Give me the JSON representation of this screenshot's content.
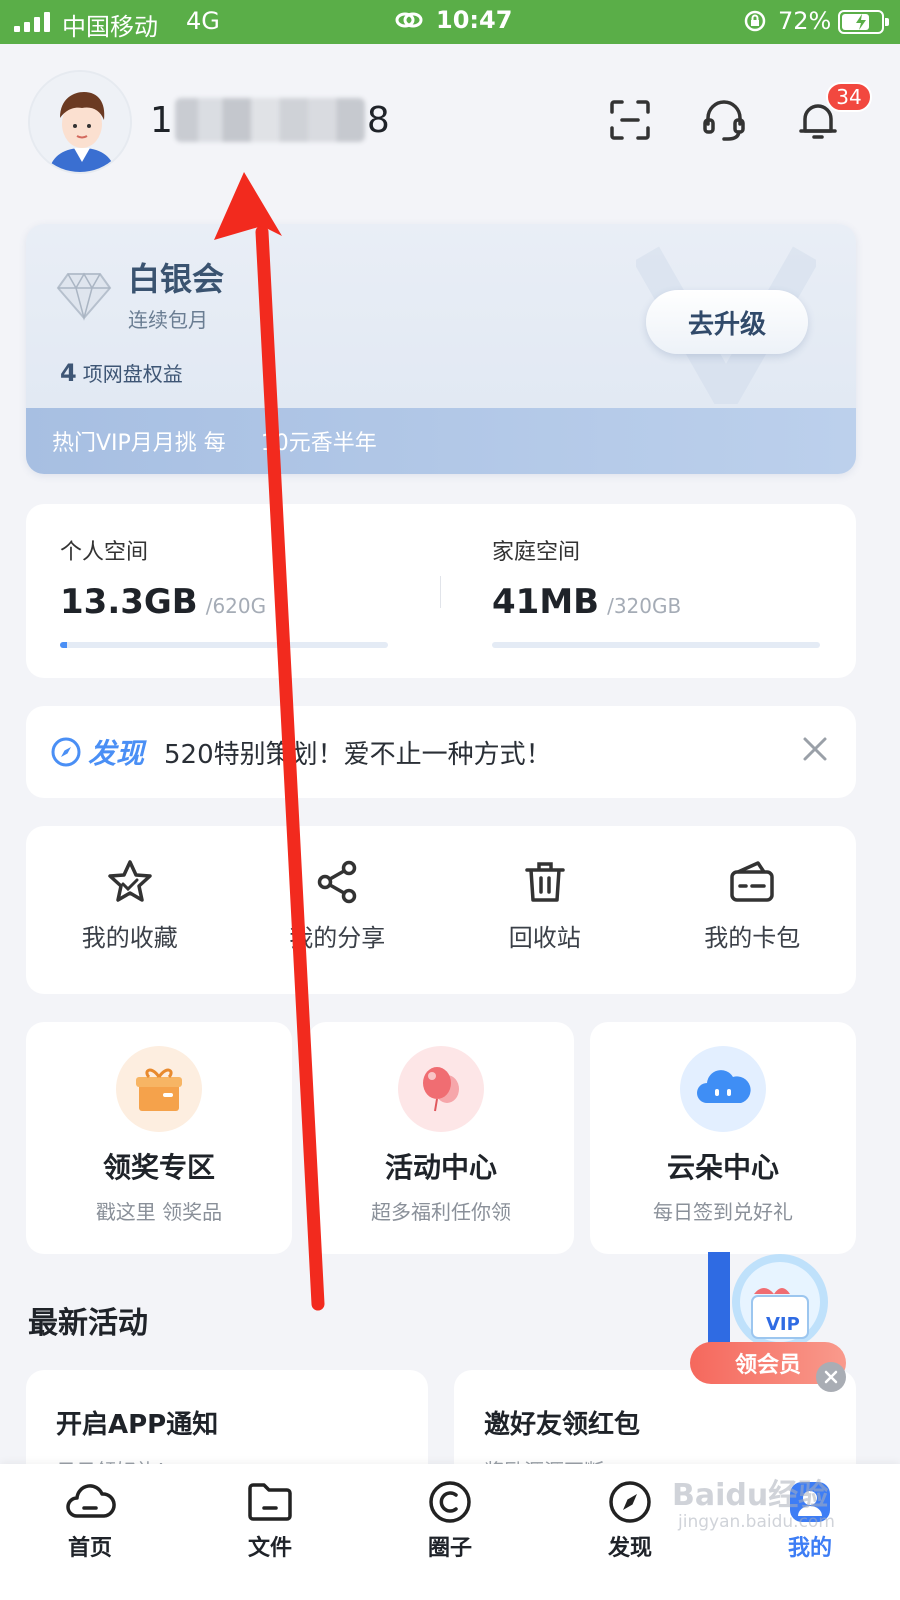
{
  "status_bar": {
    "carrier": "中国移动",
    "network": "4G",
    "time": "10:47",
    "battery": "72%",
    "battery_level": 0.72
  },
  "header": {
    "username_prefix": "1",
    "username_suffix": "8",
    "notification_count": "34",
    "icons": [
      "scan-icon",
      "headset-icon",
      "bell-icon"
    ]
  },
  "vip": {
    "level": "白银会",
    "subtitle": "连续包月",
    "rights_count": "4",
    "rights_label": "项网盘权益",
    "upgrade_label": "去升级",
    "promo": "热门VIP月月挑 每     10元香半年"
  },
  "storage": {
    "personal": {
      "label": "个人空间",
      "used": "13.3GB",
      "total": "/620G",
      "fraction": 0.021
    },
    "family": {
      "label": "家庭空间",
      "used": "41MB",
      "total": "/320GB",
      "fraction": 0.0
    }
  },
  "discover": {
    "tag": "发现",
    "text": "520特别策划！爱不止一种方式！"
  },
  "shortcuts": [
    {
      "label": "我的收藏",
      "icon": "star-icon"
    },
    {
      "label": "我的分享",
      "icon": "share-icon"
    },
    {
      "label": "回收站",
      "icon": "trash-icon"
    },
    {
      "label": "我的卡包",
      "icon": "card-wallet-icon"
    }
  ],
  "features": [
    {
      "title": "领奖专区",
      "subtitle": "戳这里 领奖品",
      "icon": "gift-icon",
      "color": "#f5a24b"
    },
    {
      "title": "活动中心",
      "subtitle": "超多福利任你领",
      "icon": "balloon-icon",
      "color": "#f06d72"
    },
    {
      "title": "云朵中心",
      "subtitle": "每日签到兑好礼",
      "icon": "cloud-icon",
      "color": "#3f8ef5"
    }
  ],
  "floating_vip": {
    "label": "领会员",
    "badge": "VIP"
  },
  "latest": {
    "title": "最新活动",
    "items": [
      {
        "title": "开启APP通知",
        "subtitle": "日日领好礼！"
      },
      {
        "title": "邀好友领红包",
        "subtitle": "奖励源源不断"
      }
    ]
  },
  "tabs": [
    {
      "label": "首页",
      "icon": "cloud-home-icon"
    },
    {
      "label": "文件",
      "icon": "folder-icon"
    },
    {
      "label": "圈子",
      "icon": "circle-icon"
    },
    {
      "label": "发现",
      "icon": "compass-icon"
    },
    {
      "label": "我的",
      "icon": "profile-icon",
      "active": true
    }
  ],
  "watermark": {
    "line1": "Baidu经验",
    "line2": "jingyan.baidu.com"
  },
  "colors": {
    "status_bar": "#5aae48",
    "accent": "#4a8ff5",
    "badge": "#f2483f",
    "arrow": "#f22a1e"
  }
}
